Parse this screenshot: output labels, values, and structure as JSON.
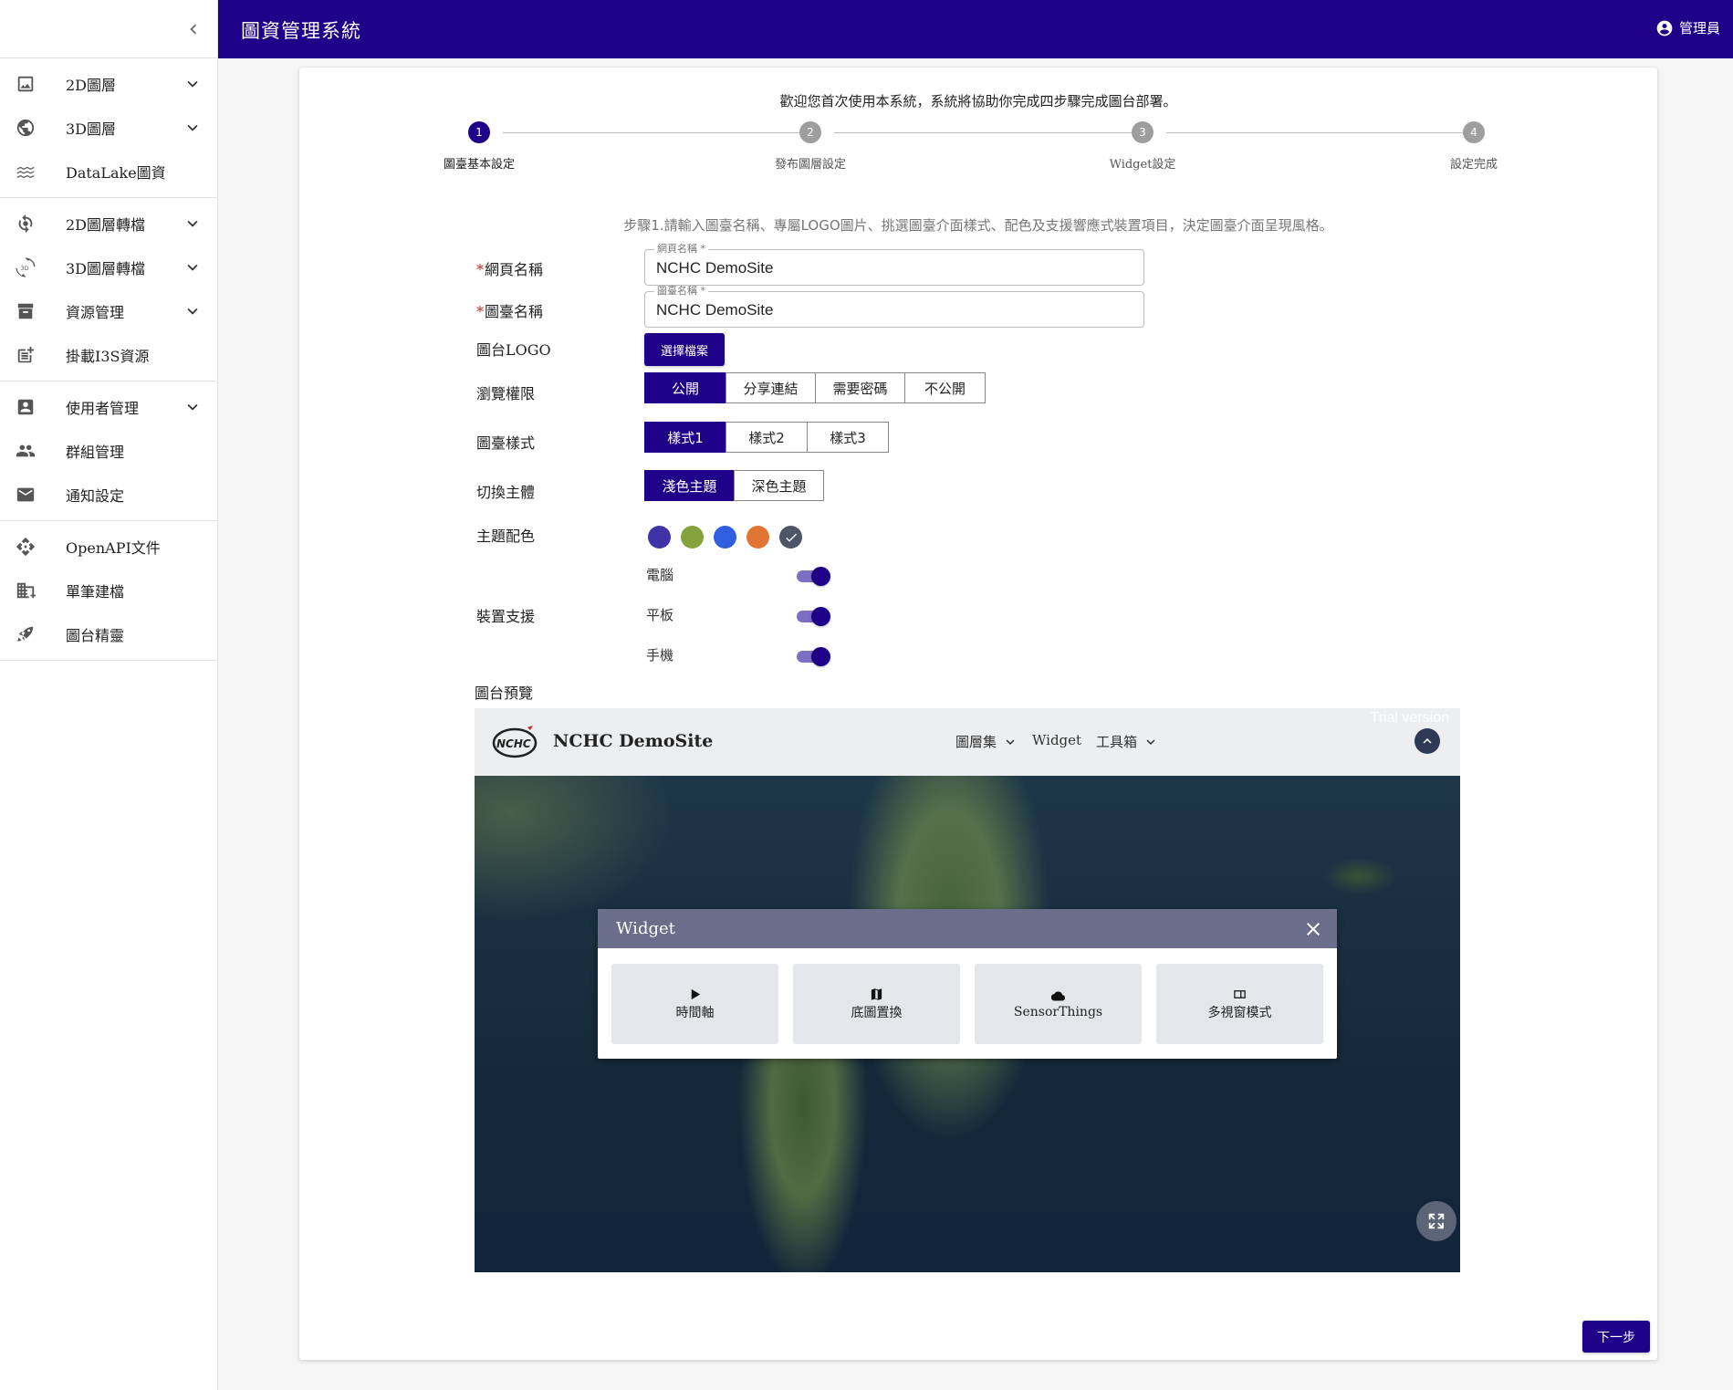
{
  "header": {
    "title": "圖資管理系統",
    "user": "管理員"
  },
  "sidebar": {
    "items": [
      {
        "label": "2D圖層",
        "icon": "image-icon"
      },
      {
        "label": "3D圖層",
        "icon": "globe-icon"
      },
      {
        "label": "DataLake圖資",
        "icon": "waves-icon"
      },
      {
        "label": "2D圖層轉檔",
        "icon": "sync-icon"
      },
      {
        "label": "3D圖層轉檔",
        "icon": "3d-rotation-icon"
      },
      {
        "label": "資源管理",
        "icon": "archive-icon"
      },
      {
        "label": "掛載I3S資源",
        "icon": "post-add-icon"
      },
      {
        "label": "使用者管理",
        "icon": "account-box-icon"
      },
      {
        "label": "群組管理",
        "icon": "people-icon"
      },
      {
        "label": "通知設定",
        "icon": "mail-icon"
      },
      {
        "label": "OpenAPI文件",
        "icon": "api-icon"
      },
      {
        "label": "單筆建檔",
        "icon": "domain-add-icon"
      },
      {
        "label": "圖台精靈",
        "icon": "rocket-icon"
      }
    ]
  },
  "wizard": {
    "welcome": "歡迎您首次使用本系統，系統將協助你完成四步驟完成圖台部署。",
    "steps": [
      {
        "num": "1",
        "label": "圖臺基本設定"
      },
      {
        "num": "2",
        "label": "發布圖層設定"
      },
      {
        "num": "3",
        "label": "Widget設定"
      },
      {
        "num": "4",
        "label": "設定完成"
      }
    ],
    "instruction": "步驟1.請輸入圖臺名稱、專屬LOGO圖片、挑選圖臺介面樣式、配色及支援響應式裝置項目，決定圖臺介面呈現風格。",
    "fields": {
      "page_name": {
        "label": "網頁名稱",
        "float_label": "網頁名稱 *",
        "value": "NCHC DemoSite"
      },
      "map_name": {
        "label": "圖臺名稱",
        "float_label": "圖臺名稱 *",
        "value": "NCHC DemoSite"
      }
    },
    "logo": {
      "label": "圖台LOGO",
      "button": "選擇檔案"
    },
    "permission": {
      "label": "瀏覽權限",
      "options": [
        "公開",
        "分享連結",
        "需要密碼",
        "不公開"
      ],
      "selected": "公開"
    },
    "style": {
      "label": "圖臺樣式",
      "options": [
        "樣式1",
        "樣式2",
        "樣式3"
      ],
      "selected": "樣式1"
    },
    "theme": {
      "label": "切換主體",
      "options": [
        "淺色主題",
        "深色主題"
      ],
      "selected": "淺色主題"
    },
    "colors": {
      "label": "主題配色",
      "swatches": [
        "#3f33a5",
        "#84a33d",
        "#2f5fe0",
        "#e07534",
        "#4d5566"
      ],
      "selected": "#4d5566"
    },
    "devices": {
      "label": "裝置支援",
      "items": [
        {
          "label": "電腦",
          "on": true
        },
        {
          "label": "平板",
          "on": true
        },
        {
          "label": "手機",
          "on": true
        }
      ]
    },
    "preview_label": "圖台預覽",
    "next_button": "下一步"
  },
  "preview": {
    "site_name": "NCHC DemoSite",
    "logo_text": "NCHC",
    "nav": [
      "圖層集",
      "Widget",
      "工具箱"
    ],
    "watermark": "Trial version",
    "widget": {
      "title": "Widget",
      "tiles": [
        {
          "label": "時間軸",
          "icon": "play-icon"
        },
        {
          "label": "底圖置換",
          "icon": "map-icon"
        },
        {
          "label": "SensorThings",
          "icon": "cloud-icon"
        },
        {
          "label": "多視窗模式",
          "icon": "multi-window-icon"
        }
      ]
    }
  }
}
